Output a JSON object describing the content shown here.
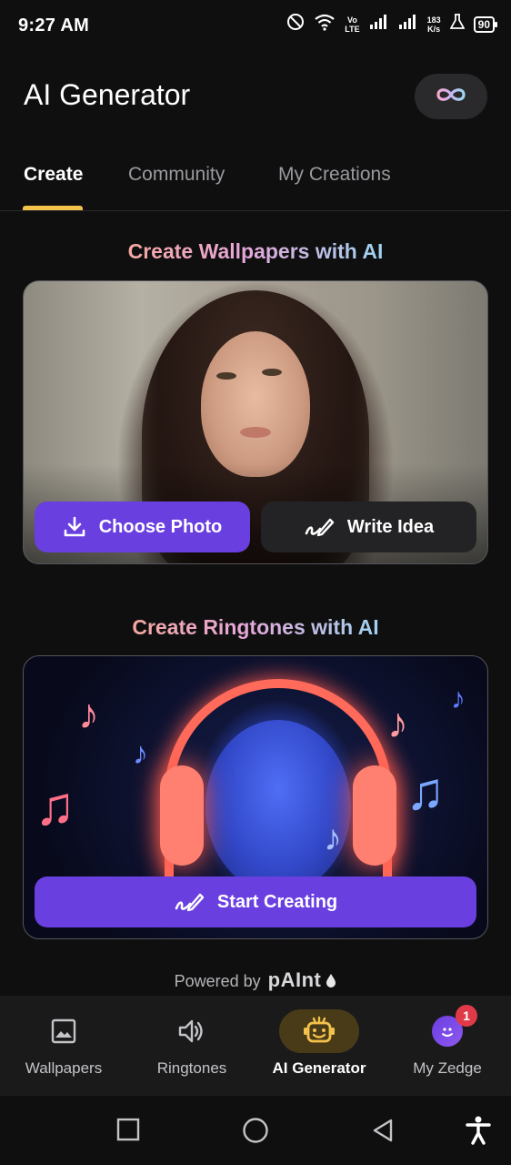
{
  "status_bar": {
    "time": "9:27 AM",
    "network_speed_value": "183",
    "network_speed_unit": "K/s",
    "volte": "Vo",
    "lte": "LTE",
    "battery": "90"
  },
  "header": {
    "title": "AI Generator",
    "infinity_icon": "infinity-icon"
  },
  "tabs": [
    {
      "label": "Create",
      "active": true
    },
    {
      "label": "Community",
      "active": false
    },
    {
      "label": "My Creations",
      "active": false
    }
  ],
  "wallpapers_section": {
    "title": "Create Wallpapers with AI",
    "choose_photo_label": "Choose Photo",
    "write_idea_label": "Write Idea"
  },
  "ringtones_section": {
    "title": "Create Ringtones with AI",
    "start_creating_label": "Start Creating"
  },
  "powered_by": {
    "text": "Powered by",
    "brand": "pAInt"
  },
  "bottom_nav": [
    {
      "label": "Wallpapers",
      "icon": "image-icon",
      "active": false
    },
    {
      "label": "Ringtones",
      "icon": "speaker-icon",
      "active": false
    },
    {
      "label": "AI Generator",
      "icon": "robot-icon",
      "active": true
    },
    {
      "label": "My Zedge",
      "icon": "avatar-icon",
      "active": false,
      "badge": "1"
    }
  ],
  "colors": {
    "accent_purple": "#6a3fe0",
    "tab_indicator": "#f3c24b",
    "badge_red": "#e03a48"
  }
}
